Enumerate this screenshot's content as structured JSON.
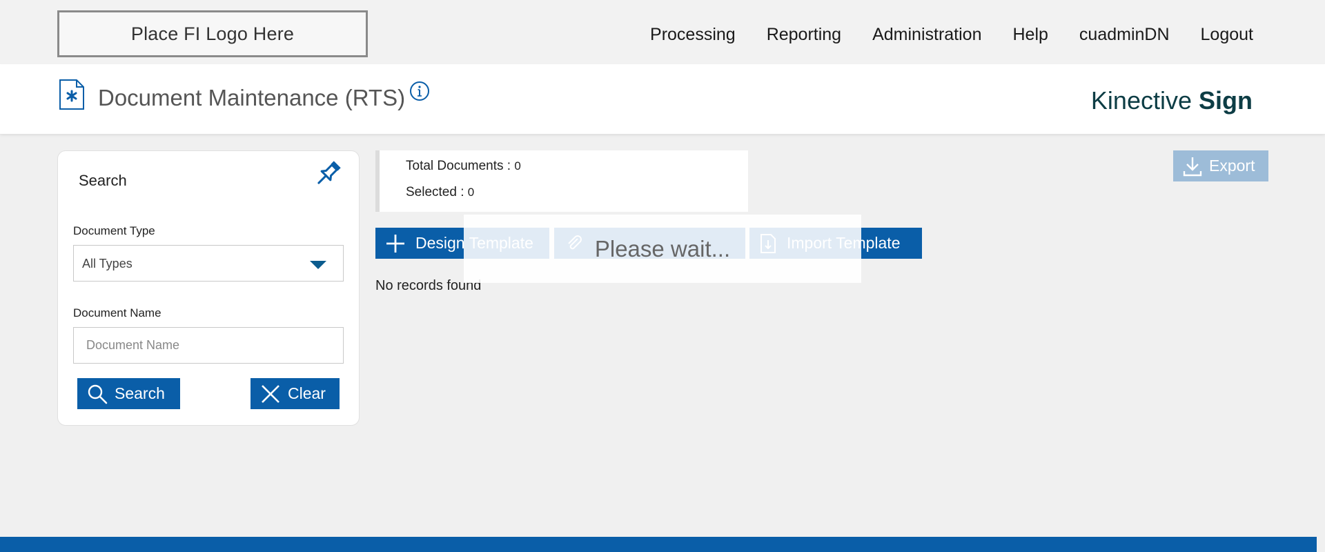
{
  "logo": {
    "text": "Place FI Logo Here"
  },
  "nav": {
    "processing": "Processing",
    "reporting": "Reporting",
    "administration": "Administration",
    "help": "Help",
    "user": "cuadminDN",
    "logout": "Logout"
  },
  "header": {
    "title": "Document Maintenance (RTS)",
    "brand_light": "Kinective",
    "brand_bold": "Sign"
  },
  "search": {
    "title": "Search",
    "doc_type_label": "Document Type",
    "doc_type_value": "All Types",
    "doc_name_label": "Document Name",
    "doc_name_placeholder": "Document Name",
    "search_button": "Search",
    "clear_button": "Clear"
  },
  "summary": {
    "total_label": "Total Documents :",
    "total_value": "0",
    "selected_label": "Selected :",
    "selected_value": "0"
  },
  "actions": {
    "export": "Export",
    "design_template": "Design Template",
    "import_template": "Import Template"
  },
  "results": {
    "empty_text": "No records found"
  },
  "overlay": {
    "text": "Please wait..."
  },
  "colors": {
    "primary": "#0a5ea8",
    "export_disabled": "#9dbcd8",
    "brand_text": "#0d3d45",
    "background": "#f0f0f0"
  },
  "icons": {
    "doc": "document-settings-icon",
    "info": "info-icon",
    "pin": "pin-icon",
    "search": "search-icon",
    "clear": "close-icon",
    "export": "download-icon",
    "design": "plus-icon",
    "mid": "attachment-icon",
    "import": "import-icon"
  }
}
